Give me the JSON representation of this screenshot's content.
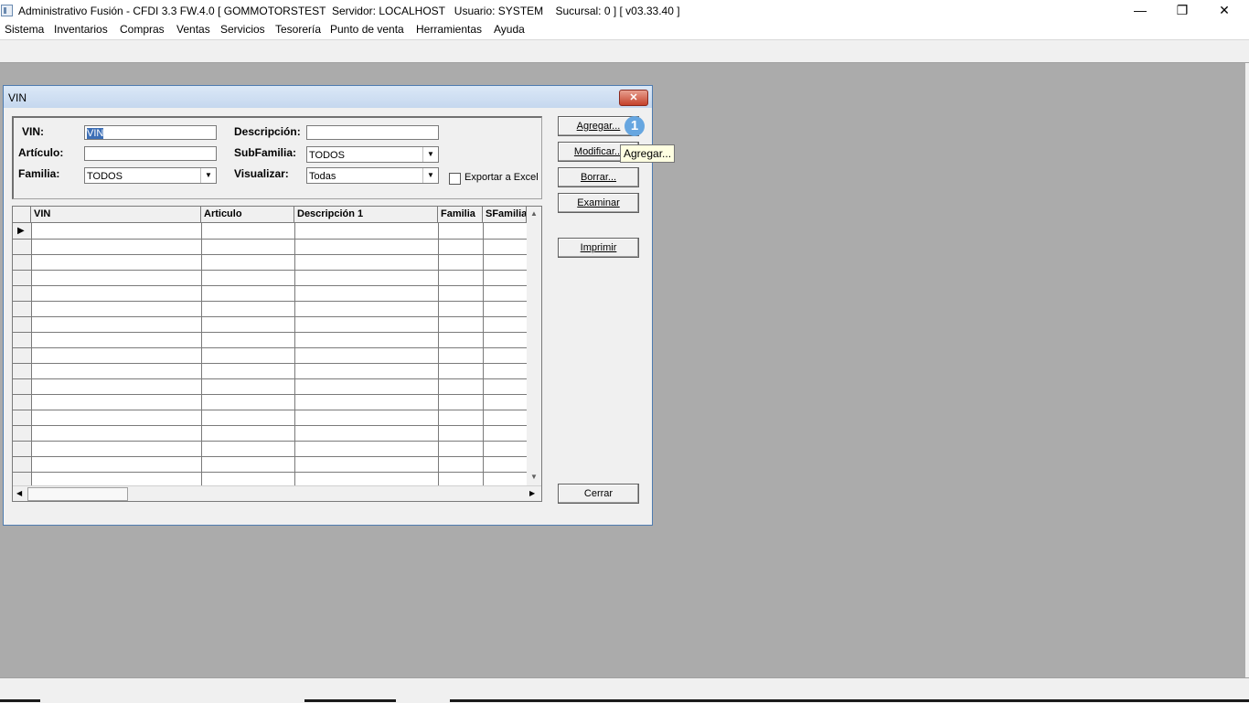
{
  "app": {
    "title": "Administrativo Fusión - CFDI 3.3 FW.4.0 [ GOMMOTORSTEST  Servidor: LOCALHOST   Usuario: SYSTEM    Sucursal: 0 ] [ v03.33.40 ]",
    "minimize_glyph": "—",
    "maximize_glyph": "❐",
    "close_glyph": "✕"
  },
  "menu": [
    "Sistema",
    "Inventarios",
    "Compras",
    "Ventas",
    "Servicios",
    "Tesorería",
    "Punto de venta",
    "Herramientas",
    "Ayuda"
  ],
  "dialog": {
    "title": "VIN",
    "close_glyph": "✕",
    "filters": {
      "vin_label": "VIN:",
      "vin_value": "VIN",
      "articulo_label": "Artículo:",
      "articulo_value": "",
      "familia_label": "Familia:",
      "familia_value": "TODOS",
      "descripcion_label": "Descripción:",
      "descripcion_value": "",
      "subfamilia_label": "SubFamilia:",
      "subfamilia_value": "TODOS",
      "visualizar_label": "Visualizar:",
      "visualizar_value": "Todas",
      "exportar_label": "Exportar a Excel",
      "exportar_checked": false
    },
    "buttons": {
      "agregar": "Agregar...",
      "modificar": "Modificar...",
      "borrar": "Borrar...",
      "examinar": "Examinar",
      "imprimir": "Imprimir",
      "cerrar": "Cerrar"
    },
    "badge": "1",
    "tooltip": "Agregar...",
    "grid": {
      "columns": [
        "VIN",
        "Articulo",
        "Descripción 1",
        "Familia",
        "SFamilia"
      ],
      "row_indicator": "▶",
      "rows": []
    }
  }
}
